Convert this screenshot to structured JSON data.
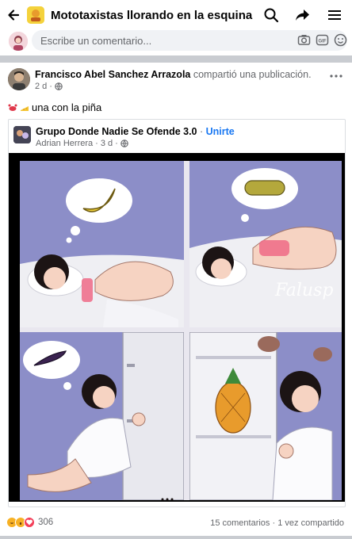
{
  "header": {
    "title": "Mototaxistas llorando en la esquina 🦀🧀 (..."
  },
  "composer": {
    "placeholder": "Escribe un comentario..."
  },
  "post": {
    "author": "Francisco Abel Sanchez Arrazola",
    "action": "compartió una publicación.",
    "time": "2 d",
    "caption": "una con la piña"
  },
  "shared": {
    "group_name": "Grupo Donde Nadie Se Ofende 3.0",
    "join_label": "Unirte",
    "author": "Adrian Herrera",
    "time": "3 d",
    "watermark": "Falusp"
  },
  "footer": {
    "reaction_count": "306",
    "comments": "15 comentarios",
    "separator": "·",
    "shares": "1 vez compartido"
  },
  "colors": {
    "accent": "#1877f2",
    "panel_bg": "#8e90c9",
    "divider": "#c9ccd1"
  }
}
